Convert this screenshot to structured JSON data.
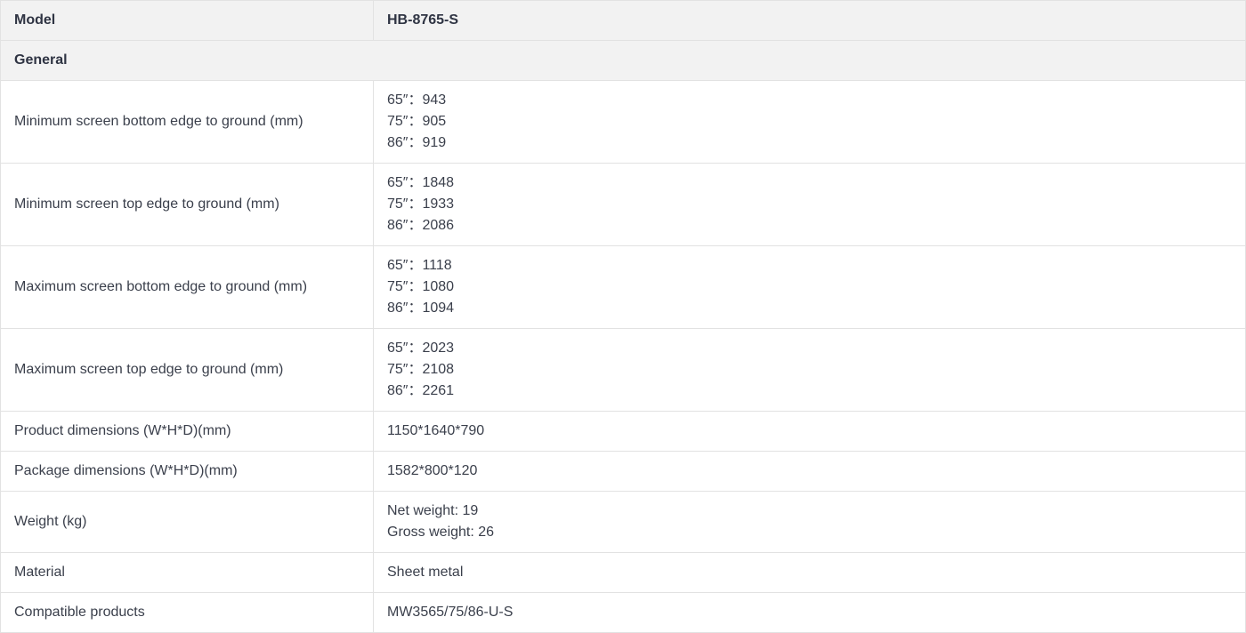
{
  "table": {
    "header": {
      "label": "Model",
      "value": "HB-8765-S"
    },
    "section": "General",
    "rows": [
      {
        "label": "Minimum screen bottom edge to ground (mm)",
        "lines": [
          "65″：943",
          "75″：905",
          "86″：919"
        ]
      },
      {
        "label": "Minimum screen top edge to ground (mm)",
        "lines": [
          "65″：1848",
          "75″：1933",
          "86″：2086"
        ]
      },
      {
        "label": "Maximum screen bottom edge to ground (mm)",
        "lines": [
          "65″：1118",
          "75″：1080",
          "86″：1094"
        ]
      },
      {
        "label": "Maximum screen top edge to ground (mm)",
        "lines": [
          "65″：2023",
          "75″：2108",
          "86″：2261"
        ]
      },
      {
        "label": "Product dimensions (W*H*D)(mm)",
        "lines": [
          "1150*1640*790"
        ]
      },
      {
        "label": "Package dimensions (W*H*D)(mm)",
        "lines": [
          "1582*800*120"
        ]
      },
      {
        "label": "Weight (kg)",
        "lines": [
          "Net weight: 19",
          "Gross weight: 26"
        ]
      },
      {
        "label": "Material",
        "lines": [
          "Sheet metal"
        ]
      },
      {
        "label": "Compatible products",
        "lines": [
          "MW3565/75/86-U-S"
        ]
      }
    ]
  }
}
